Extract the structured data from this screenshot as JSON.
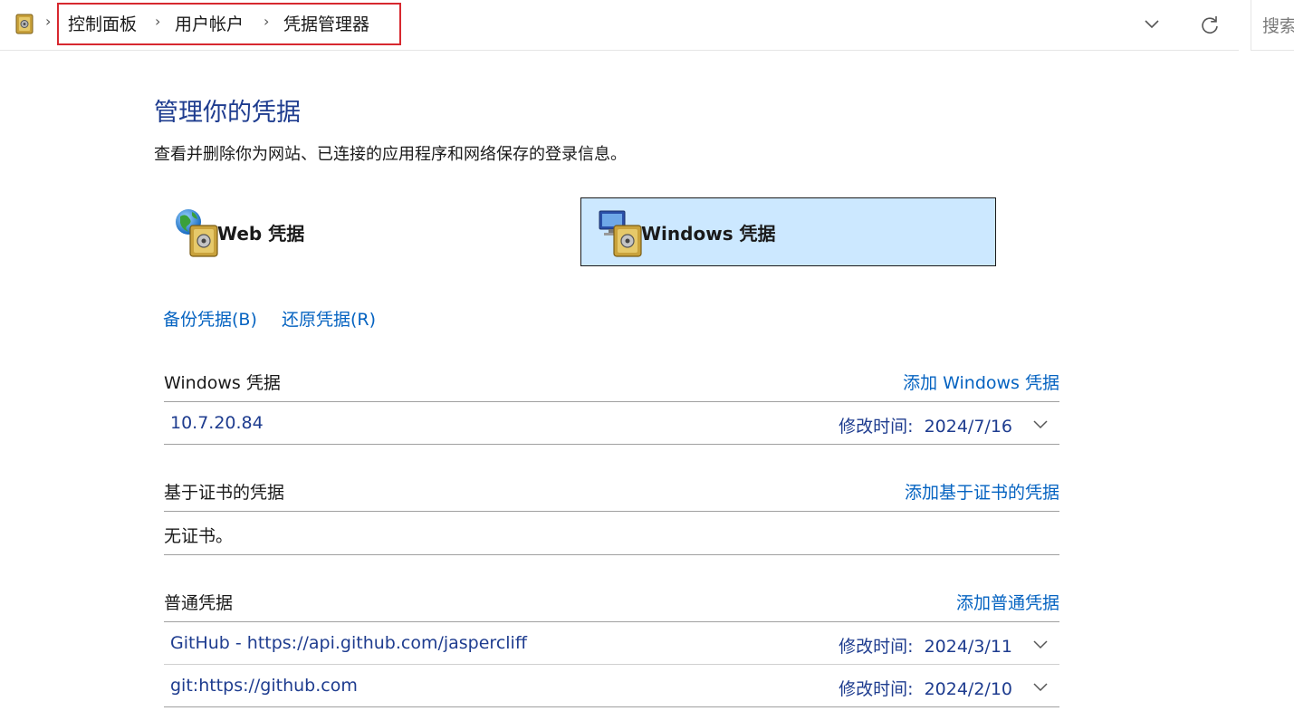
{
  "address_bar": {
    "breadcrumb": [
      "控制面板",
      "用户帐户",
      "凭据管理器"
    ],
    "search_placeholder": "搜索"
  },
  "main": {
    "title": "管理你的凭据",
    "description": "查看并删除你为网站、已连接的应用程序和网络保存的登录信息。",
    "tabs": [
      {
        "label": "Web 凭据",
        "icon": "web-credential-icon",
        "selected": false
      },
      {
        "label": "Windows 凭据",
        "icon": "windows-credential-icon",
        "selected": true
      }
    ],
    "links": {
      "backup": "备份凭据(B)",
      "restore": "还原凭据(R)"
    },
    "sections": {
      "windows": {
        "title": "Windows 凭据",
        "add_label": "添加 Windows 凭据",
        "items": [
          {
            "name": "10.7.20.84",
            "modified_label": "修改时间:",
            "modified_date": "2024/7/16"
          }
        ]
      },
      "certificate": {
        "title": "基于证书的凭据",
        "add_label": "添加基于证书的凭据",
        "empty_text": "无证书。"
      },
      "generic": {
        "title": "普通凭据",
        "add_label": "添加普通凭据",
        "items": [
          {
            "name": "GitHub - https://api.github.com/jaspercliff",
            "modified_label": "修改时间:",
            "modified_date": "2024/3/11"
          },
          {
            "name": "git:https://github.com",
            "modified_label": "修改时间:",
            "modified_date": "2024/2/10"
          }
        ]
      }
    }
  },
  "colors": {
    "title_blue": "#1e3c8f",
    "link_blue": "#0563c1",
    "selected_tab_bg": "#cce8ff",
    "breadcrumb_highlight": "#d7282f"
  }
}
